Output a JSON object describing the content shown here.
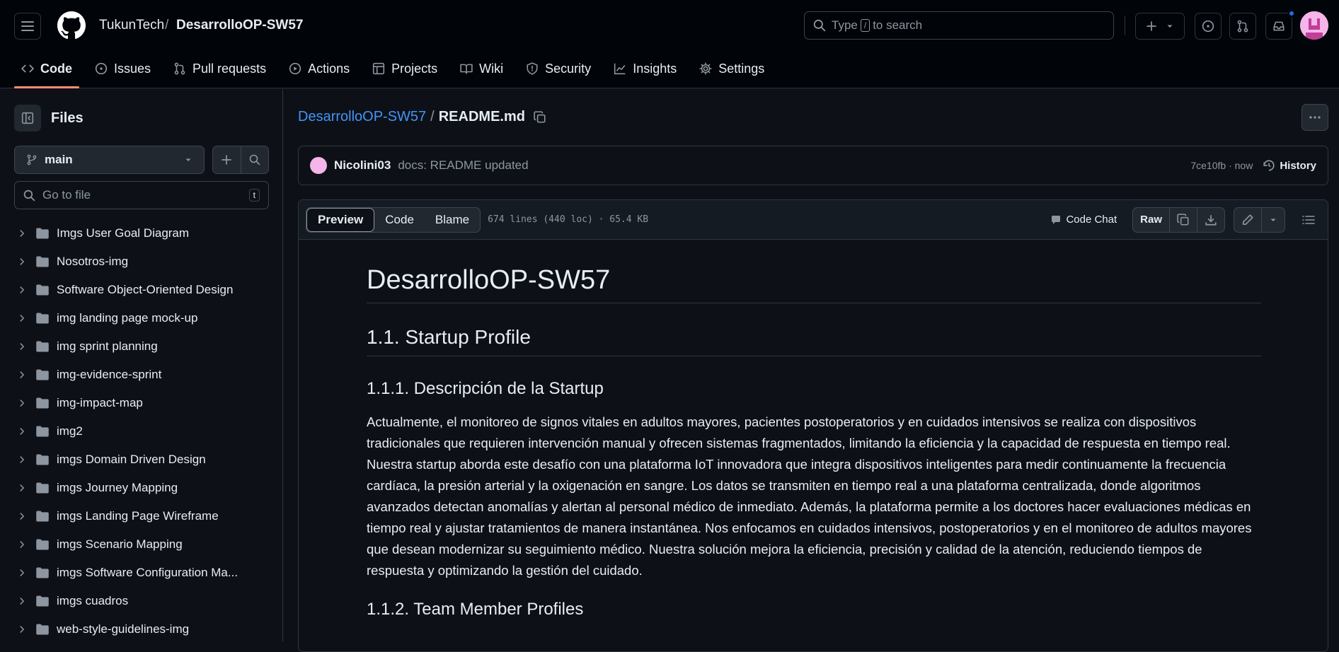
{
  "header": {
    "owner": "TukunTech",
    "separator": "/",
    "repo": "DesarrolloOP-SW57",
    "search_prefix": "Type",
    "search_key": "/",
    "search_suffix": "to search"
  },
  "nav": {
    "items": [
      {
        "label": "Code",
        "icon": "code-icon"
      },
      {
        "label": "Issues",
        "icon": "issue-icon"
      },
      {
        "label": "Pull requests",
        "icon": "pull-request-icon"
      },
      {
        "label": "Actions",
        "icon": "play-icon"
      },
      {
        "label": "Projects",
        "icon": "table-icon"
      },
      {
        "label": "Wiki",
        "icon": "book-icon"
      },
      {
        "label": "Security",
        "icon": "shield-icon"
      },
      {
        "label": "Insights",
        "icon": "graph-icon"
      },
      {
        "label": "Settings",
        "icon": "gear-icon"
      }
    ]
  },
  "sidebar": {
    "title": "Files",
    "branch": "main",
    "goto_placeholder": "Go to file",
    "goto_shortcut": "t",
    "tree": [
      "Imgs User Goal Diagram",
      "Nosotros-img",
      "Software Object-Oriented Design",
      "img landing page mock-up",
      "img sprint planning",
      "img-evidence-sprint",
      "img-impact-map",
      "img2",
      "imgs Domain Driven Design",
      "imgs Journey Mapping",
      "imgs Landing Page Wireframe",
      "imgs Scenario Mapping",
      "imgs Software Configuration Ma...",
      "imgs cuadros",
      "web-style-guidelines-img"
    ]
  },
  "file": {
    "repo_link": "DesarrolloOP-SW57",
    "separator": "/",
    "name": "README.md",
    "commit_author": "Nicolini03",
    "commit_message": "docs: README updated",
    "commit_sha": "7ce10fb · now",
    "history_label": "History",
    "tabs": [
      "Preview",
      "Code",
      "Blame"
    ],
    "meta": "674 lines (440 loc) · 65.4 KB",
    "code_chat": "Code Chat",
    "raw": "Raw"
  },
  "readme": {
    "h1": "DesarrolloOP-SW57",
    "h2": "1.1. Startup Profile",
    "h3a": "1.1.1. Descripción de la Startup",
    "para": "Actualmente, el monitoreo de signos vitales en adultos mayores, pacientes postoperatorios y en cuidados intensivos se realiza con dispositivos tradicionales que requieren intervención manual y ofrecen sistemas fragmentados, limitando la eficiencia y la capacidad de respuesta en tiempo real. Nuestra startup aborda este desafío con una plataforma IoT innovadora que integra dispositivos inteligentes para medir continuamente la frecuencia cardíaca, la presión arterial y la oxigenación en sangre. Los datos se transmiten en tiempo real a una plataforma centralizada, donde algoritmos avanzados detectan anomalías y alertan al personal médico de inmediato. Además, la plataforma permite a los doctores hacer evaluaciones médicas en tiempo real y ajustar tratamientos de manera instantánea. Nos enfocamos en cuidados intensivos, postoperatorios y en el monitoreo de adultos mayores que desean modernizar su seguimiento médico. Nuestra solución mejora la eficiencia, precisión y calidad de la atención, reduciendo tiempos de respuesta y optimizando la gestión del cuidado.",
    "h3b": "1.1.2. Team Member Profiles"
  },
  "colors": {
    "accent_link": "#4493f8",
    "tab_underline": "#fd8c73",
    "notification": "#1f6feb",
    "avatar": "#f4b5e8"
  }
}
